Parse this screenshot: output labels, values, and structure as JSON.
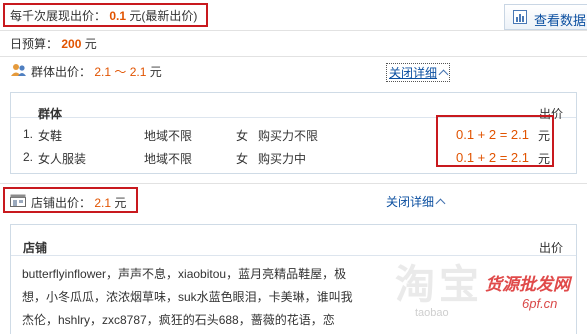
{
  "top": {
    "cpm_label": "每千次展现出价：",
    "cpm_value": "0.1",
    "cpm_unit": "元(最新出价)",
    "view_data_label": "查看数据"
  },
  "budget": {
    "label": "日预算：",
    "value": "200",
    "unit": "元"
  },
  "group_bid": {
    "label": "群体出价：",
    "range": "2.1 ～ 2.1",
    "unit": "元",
    "close_detail": "关闭详细",
    "header_group": "群体",
    "header_bid": "出价",
    "rows": [
      {
        "index": "1.",
        "name": "女鞋",
        "region": "地域不限",
        "gender": "女",
        "power": "购买力不限",
        "formula": "0.1 + 2 = 2.1",
        "unit": "元"
      },
      {
        "index": "2.",
        "name": "女人服装",
        "region": "地域不限",
        "gender": "女",
        "power": "购买力中",
        "formula": "0.1 + 2 = 2.1",
        "unit": "元"
      }
    ]
  },
  "shop_bid": {
    "label": "店铺出价：",
    "value": "2.1",
    "unit": "元",
    "close_detail": "关闭详细",
    "header_shop": "店铺",
    "header_bid": "出价",
    "line1": "butterflyinflower，声声不息，xiaobitou，蓝月亮精品鞋屋，极",
    "line2": "想，小冬瓜瓜，浓浓烟草味，suk水蓝色眼泪，卡美琳，谁叫我",
    "line3": "杰伦，hshlry，zxc8787，疯狂的石头688，蔷薇的花语，恋"
  },
  "watermark": {
    "taobao": "淘宝",
    "site_cn": "货源批发网",
    "site_url": "6pf.cn",
    "url_fragment": "taobao"
  },
  "colors": {
    "accent": "#e15300",
    "highlight_border": "#c8191e",
    "link": "#0b4fa0"
  }
}
